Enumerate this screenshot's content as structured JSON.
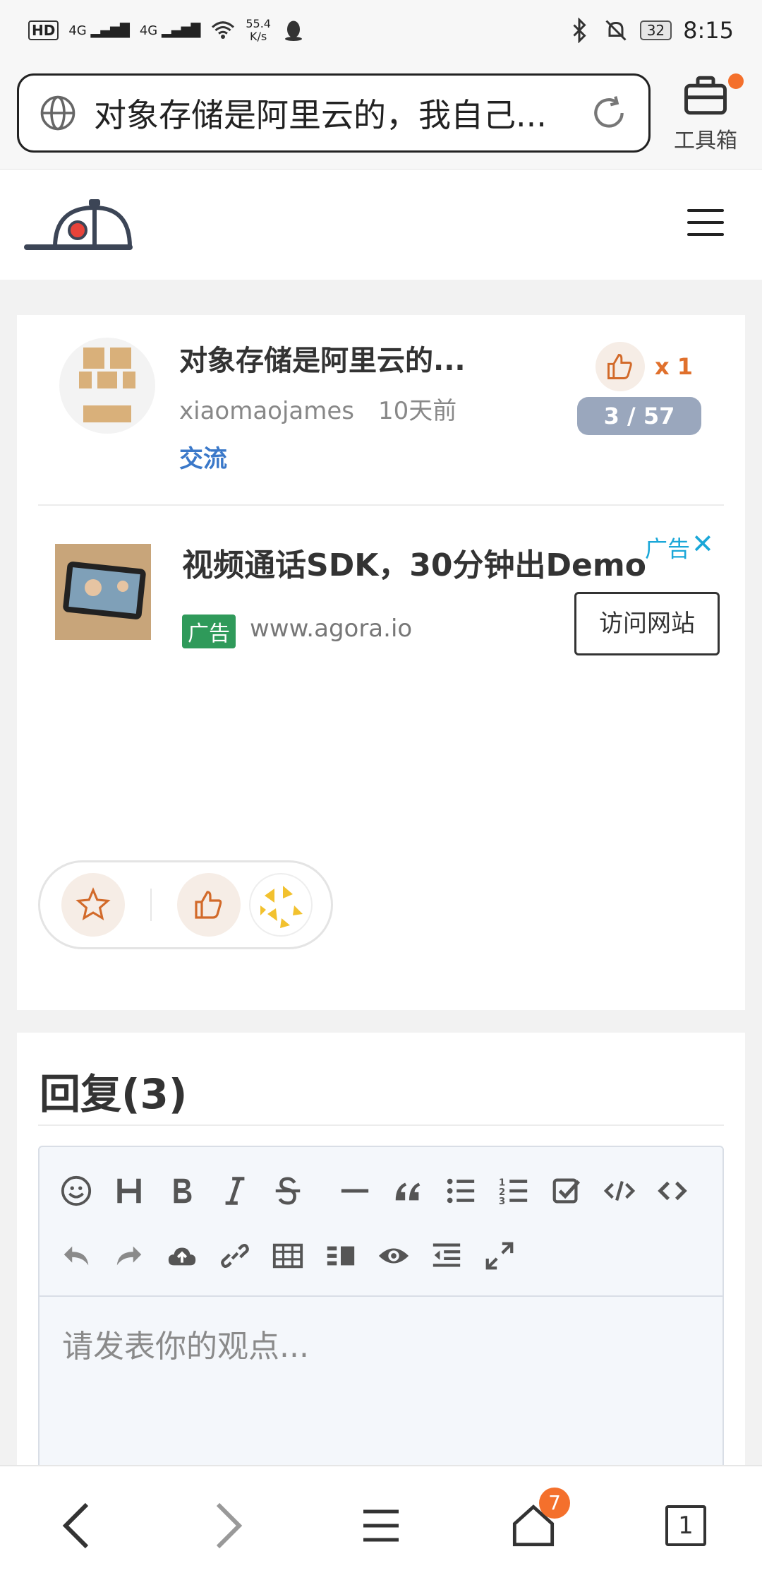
{
  "status_bar": {
    "hd": "HD",
    "signal1": "4G",
    "signal2": "4G",
    "net_speed": "55.4",
    "net_unit": "K/s",
    "battery": "32",
    "time": "8:15"
  },
  "browser": {
    "url_text": "对象存储是阿里云的，我自己...",
    "toolbox_label": "工具箱"
  },
  "topic": {
    "title": "对象存储是阿里云的...",
    "author": "xiaomaojames",
    "time_ago": "10天前",
    "tag": "交流",
    "like_count": "x 1",
    "page_indicator": "3 / 57"
  },
  "ad": {
    "title": "视频通话SDK，30分钟出Demo",
    "label": "广告",
    "close": "✕",
    "badge": "广告",
    "url": "www.agora.io",
    "visit_label": "访问网站"
  },
  "reply": {
    "title": "回复(3)",
    "placeholder": "请发表你的观点..."
  },
  "bottom_nav": {
    "home_badge": "7",
    "tab_count": "1"
  },
  "colors": {
    "accent": "#f4702c",
    "link": "#3a78c9",
    "ad_label": "#1aa7d8",
    "ad_badge": "#2f9a5a",
    "pill": "#9aa7bd"
  }
}
